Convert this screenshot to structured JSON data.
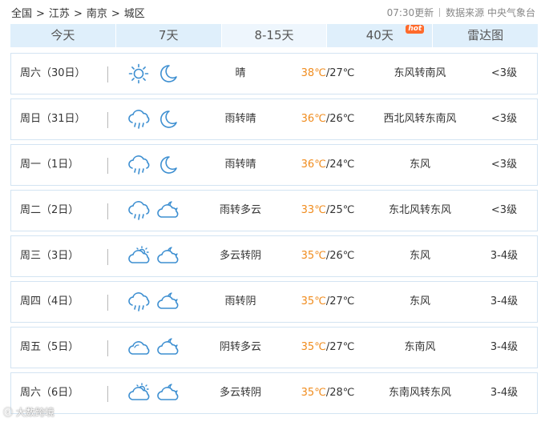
{
  "breadcrumb": {
    "items": [
      "全国",
      "江苏",
      "南京",
      "城区"
    ],
    "separator": ">"
  },
  "meta": {
    "update_time": "07:30更新",
    "source": "数据来源 中央气象台"
  },
  "tabs": [
    {
      "label": "今天",
      "active": false
    },
    {
      "label": "7天",
      "active": false
    },
    {
      "label": "8-15天",
      "active": true
    },
    {
      "label": "40天",
      "active": false,
      "badge": "hot"
    },
    {
      "label": "雷达图",
      "active": false
    }
  ],
  "forecast": [
    {
      "date": "周六（30日）",
      "day_icon": "sun-icon",
      "night_icon": "moon-icon",
      "desc": "晴",
      "high": "38℃",
      "low": "/27℃",
      "wind": "东风转南风",
      "level": "<3级"
    },
    {
      "date": "周日（31日）",
      "day_icon": "rain-icon",
      "night_icon": "moon-icon",
      "desc": "雨转晴",
      "high": "36℃",
      "low": "/26℃",
      "wind": "西北风转东南风",
      "level": "<3级"
    },
    {
      "date": "周一（1日）",
      "day_icon": "rain-icon",
      "night_icon": "moon-icon",
      "desc": "雨转晴",
      "high": "36℃",
      "low": "/24℃",
      "wind": "东风",
      "level": "<3级"
    },
    {
      "date": "周二（2日）",
      "day_icon": "rain-icon",
      "night_icon": "cloudy-night-icon",
      "desc": "雨转多云",
      "high": "33℃",
      "low": "/25℃",
      "wind": "东北风转东风",
      "level": "<3级"
    },
    {
      "date": "周三（3日）",
      "day_icon": "partly-cloudy-icon",
      "night_icon": "cloudy-night-icon",
      "desc": "多云转阴",
      "high": "35℃",
      "low": "/26℃",
      "wind": "东风",
      "level": "3-4级"
    },
    {
      "date": "周四（4日）",
      "day_icon": "rain-icon",
      "night_icon": "cloudy-night-icon",
      "desc": "雨转阴",
      "high": "35℃",
      "low": "/27℃",
      "wind": "东风",
      "level": "3-4级"
    },
    {
      "date": "周五（5日）",
      "day_icon": "overcast-icon",
      "night_icon": "cloudy-night-icon",
      "desc": "阴转多云",
      "high": "35℃",
      "low": "/27℃",
      "wind": "东南风",
      "level": "3-4级"
    },
    {
      "date": "周六（6日）",
      "day_icon": "partly-cloudy-icon",
      "night_icon": "cloudy-night-icon",
      "desc": "多云转阴",
      "high": "35℃",
      "low": "/28℃",
      "wind": "东南风转东风",
      "level": "3-4级"
    }
  ],
  "colors": {
    "accent_blue": "#3d8fd1",
    "tab_bg": "#dfeffb",
    "high_temp": "#f08c1e",
    "row_border": "#d3e4f2",
    "hot_badge": "#ff6a2b"
  },
  "watermark": "大数跨境"
}
